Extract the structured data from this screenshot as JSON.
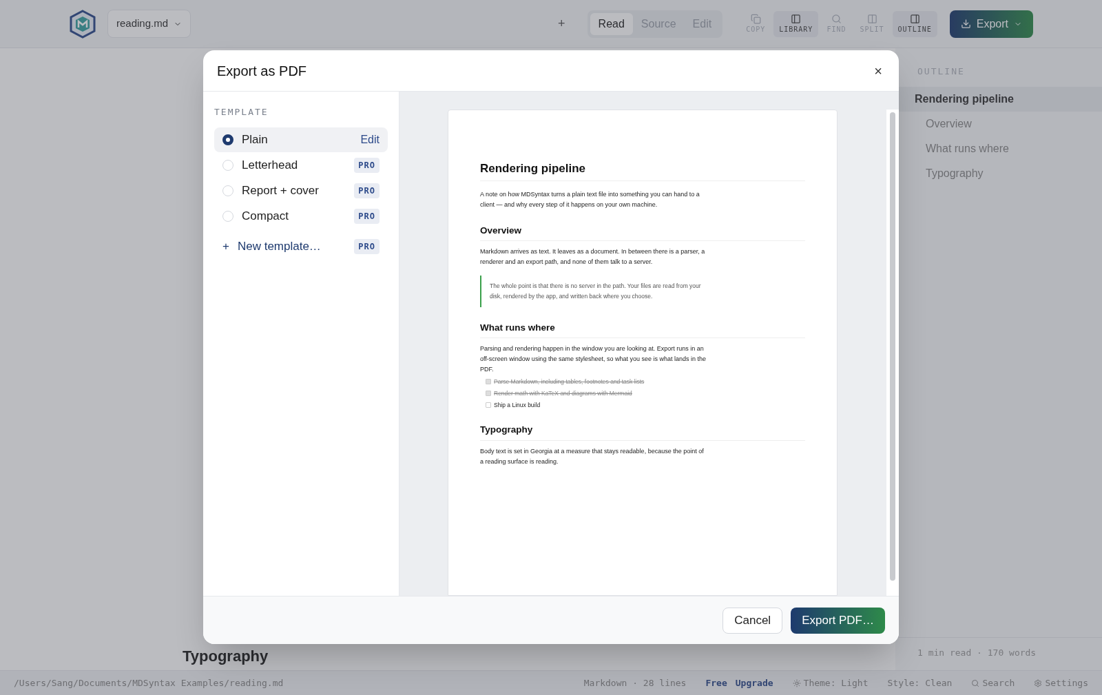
{
  "toolbar": {
    "file_name": "reading.md",
    "add": "+",
    "view_modes": [
      {
        "label": "Read",
        "selected": true
      },
      {
        "label": "Source",
        "selected": false
      },
      {
        "label": "Edit",
        "selected": false
      }
    ],
    "tools": [
      {
        "kind": "copy",
        "label": "COPY",
        "selected": false
      },
      {
        "kind": "library",
        "label": "LIBRARY",
        "selected": true
      },
      {
        "kind": "find",
        "label": "FIND",
        "selected": false
      },
      {
        "kind": "split",
        "label": "SPLIT",
        "selected": false
      },
      {
        "kind": "outline",
        "label": "OUTLINE",
        "selected": true
      }
    ],
    "export": "Export"
  },
  "outline": {
    "title": "OUTLINE",
    "items": [
      {
        "label": "Rendering pipeline",
        "selected": true,
        "children": [
          {
            "label": "Overview",
            "selected": false
          },
          {
            "label": "What runs where",
            "selected": false
          },
          {
            "label": "Typography",
            "selected": false
          }
        ]
      }
    ],
    "stats": "1 min read · 170 words"
  },
  "document": {
    "visible_heading": "Typography"
  },
  "status_bar": {
    "path": "/Users/Sang/Documents/MDSyntax Examples/reading.md",
    "info": "Markdown · 28 lines",
    "plan": "Free",
    "upgrade": "Upgrade",
    "theme": "Theme: Light",
    "style": "Style: Clean",
    "search": "Search",
    "settings": "Settings"
  },
  "dialog": {
    "title": "Export as PDF",
    "close": "×",
    "template_heading": "TEMPLATE",
    "templates": [
      {
        "label": "Plain",
        "selected": true,
        "action": "Edit"
      },
      {
        "label": "Letterhead",
        "selected": false,
        "badge": "PRO"
      },
      {
        "label": "Report + cover",
        "selected": false,
        "badge": "PRO"
      },
      {
        "label": "Compact",
        "selected": false,
        "badge": "PRO"
      }
    ],
    "new_template": {
      "icon": "+",
      "label": "New template…",
      "badge": "PRO"
    },
    "preview": [
      {
        "kind": "title",
        "text": "Rendering pipeline"
      },
      {
        "kind": "paragraph",
        "text": "A note on how MDSyntax turns a plain text file into something you can hand to a client — and why every step of it happens on your own machine."
      },
      {
        "kind": "heading",
        "text": "Overview"
      },
      {
        "kind": "paragraph",
        "text": "Markdown arrives as text. It leaves as a document. In between there is a parser, a renderer and an export path, and none of them talk to a server."
      },
      {
        "kind": "quote",
        "text": "The whole point is that there is no server in the path. Your files are read from your disk, rendered by the app, and written back where you choose."
      },
      {
        "kind": "heading",
        "text": "What runs where"
      },
      {
        "kind": "paragraph",
        "text": "Parsing and rendering happen in the window you are looking at. Export runs in an off-screen window using the same stylesheet, so what you see is what lands in the PDF."
      },
      {
        "kind": "task",
        "text": "Parse Markdown, including tables, footnotes and task lists",
        "checked": true
      },
      {
        "kind": "task",
        "text": "Render math with KaTeX and diagrams with Mermaid",
        "checked": true
      },
      {
        "kind": "task",
        "text": "Ship a Linux build",
        "checked": false
      },
      {
        "kind": "heading",
        "text": "Typography"
      },
      {
        "kind": "paragraph",
        "text": "Body text is set in Georgia at a measure that stays readable, because the point of a reading surface is reading."
      }
    ],
    "buttons": [
      {
        "kind": "secondary",
        "label": "Cancel"
      },
      {
        "kind": "primary",
        "label": "Export PDF…"
      }
    ]
  }
}
